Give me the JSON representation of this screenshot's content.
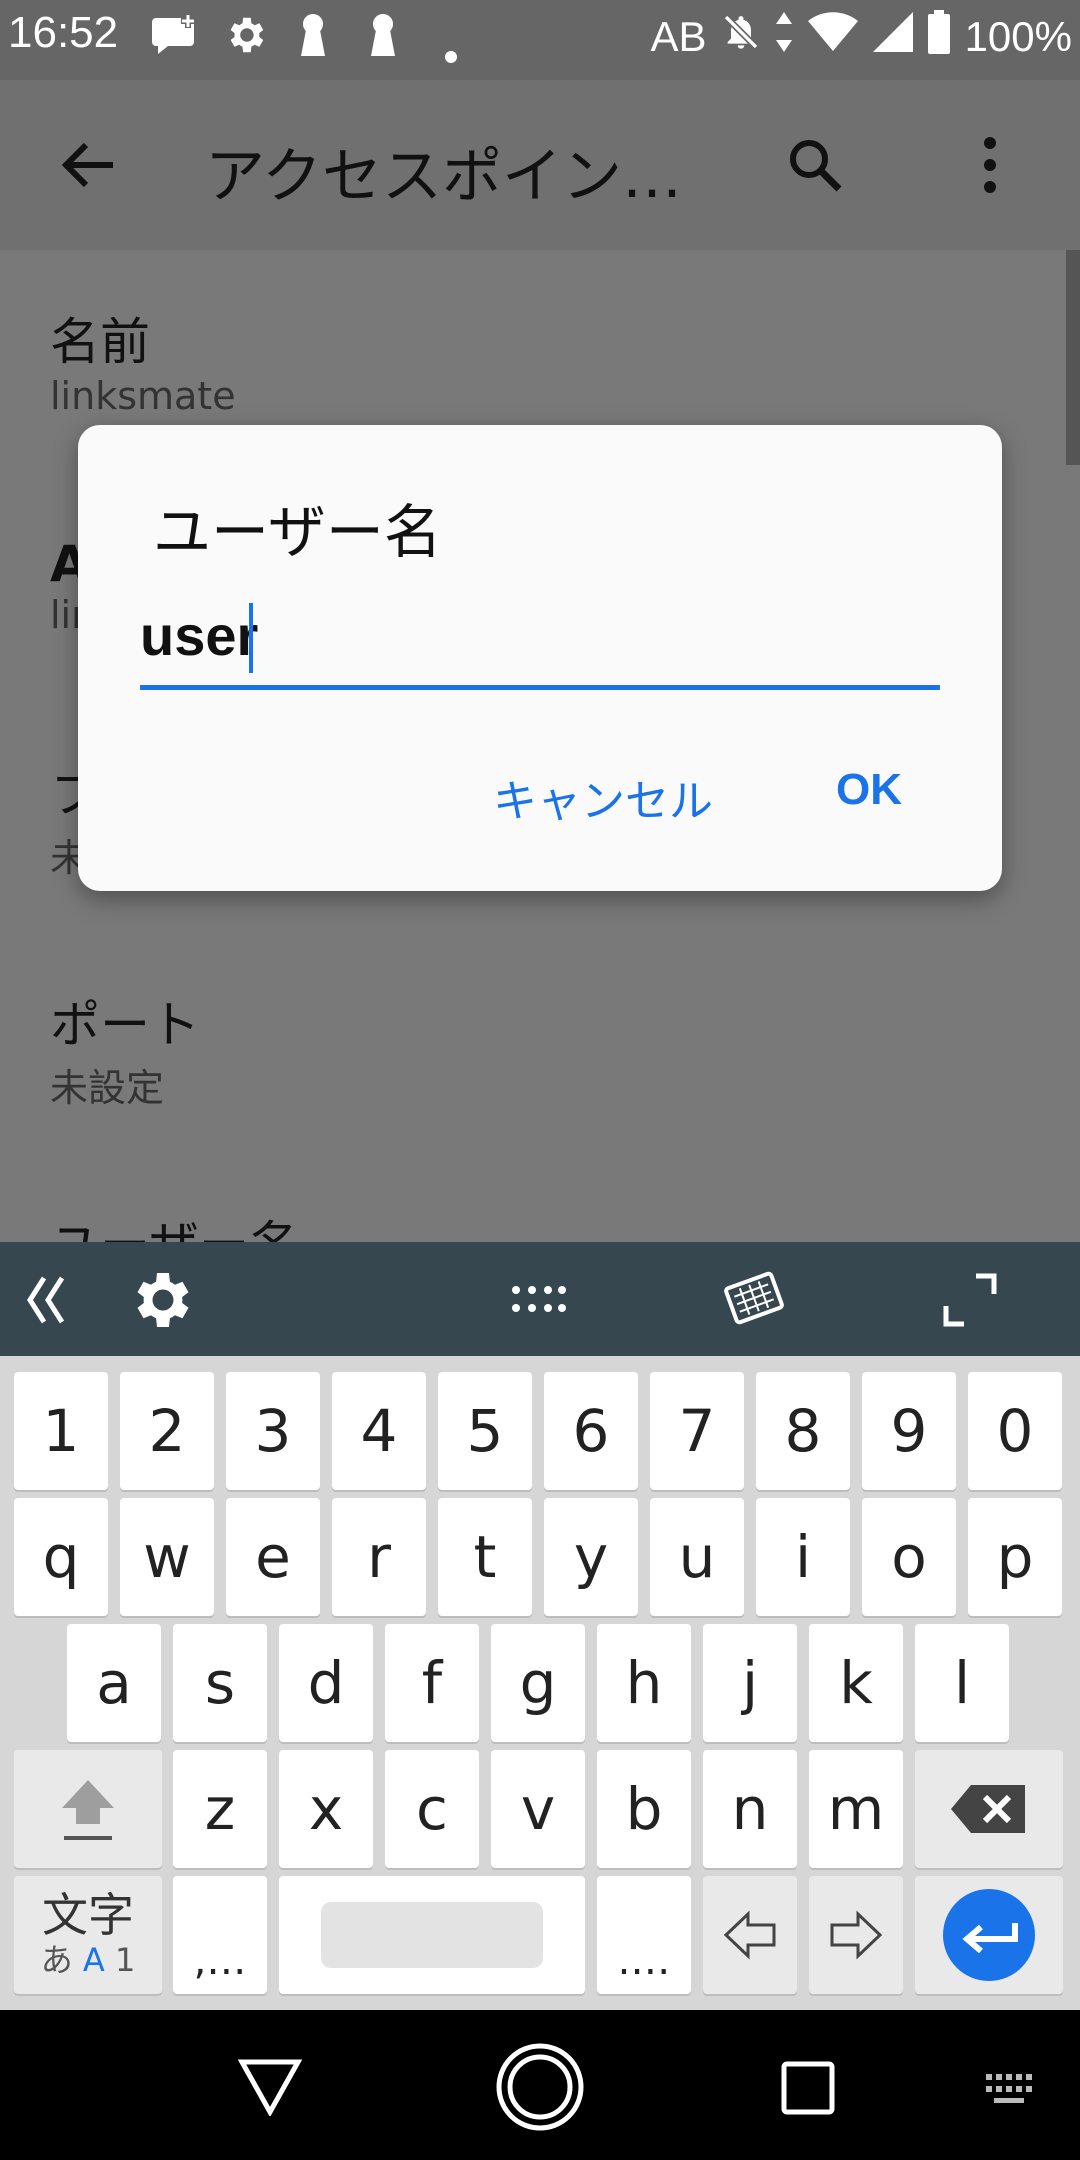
{
  "status_bar": {
    "time": "16:52",
    "carrier_text": "AB",
    "battery": "100%",
    "icons": [
      "chat-plus-icon",
      "gear-icon",
      "keyhole-icon",
      "keyhole-icon",
      "dot-icon",
      "mute-icon",
      "data-arrows-icon",
      "wifi-icon",
      "signal-icon",
      "battery-icon"
    ]
  },
  "app_bar": {
    "title": "アクセスポイン…",
    "icons": [
      "back-arrow-icon",
      "search-icon",
      "more-vert-icon"
    ]
  },
  "preferences": [
    {
      "title": "名前",
      "summary": "linksmate"
    },
    {
      "title": "A",
      "summary": "lin"
    },
    {
      "title": "フ",
      "summary": "未"
    },
    {
      "title": "ポート",
      "summary": "未設定"
    },
    {
      "title": "ユーザー名",
      "summary": ""
    }
  ],
  "dialog": {
    "title": "ユーザー名",
    "input_value": "user",
    "cancel_label": "キャンセル",
    "ok_label": "OK"
  },
  "keyboard": {
    "toolbar_icons": [
      "collapse-left-icon",
      "settings-icon",
      "grid-dots-icon",
      "keyboard-layout-icon",
      "expand-icon"
    ],
    "number_row": [
      "1",
      "2",
      "3",
      "4",
      "5",
      "6",
      "7",
      "8",
      "9",
      "0"
    ],
    "row1": [
      "q",
      "w",
      "e",
      "r",
      "t",
      "y",
      "u",
      "i",
      "o",
      "p"
    ],
    "row2": [
      "a",
      "s",
      "d",
      "f",
      "g",
      "h",
      "j",
      "k",
      "l"
    ],
    "row3": [
      "z",
      "x",
      "c",
      "v",
      "b",
      "n",
      "m"
    ],
    "mode_key": {
      "top": "文字",
      "bottom_a": "あ",
      "bottom_b": "A",
      "bottom_c": "1"
    },
    "comma_key": ",…",
    "period_key": ".…"
  },
  "nav_bar": {
    "icons": [
      "back-triangle-icon",
      "home-circle-icon",
      "recents-square-icon",
      "keyboard-switch-icon"
    ]
  },
  "colors": {
    "accent": "#1a73e8",
    "scrim": "#797979",
    "keyboard_toolbar": "#37474f"
  }
}
